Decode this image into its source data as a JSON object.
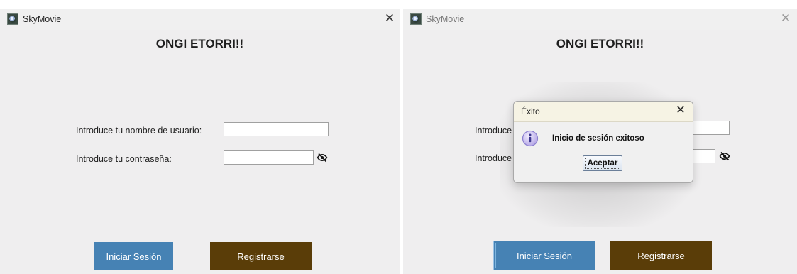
{
  "app": {
    "title": "SkyMovie",
    "close_glyph": "✕",
    "icon": "skymovie-app-icon"
  },
  "login_form": {
    "heading": "ONGI ETORRI!!",
    "username_label": "Introduce tu nombre de usuario:",
    "username_value": "",
    "password_label": "Introduce tu contraseña:",
    "password_value": "",
    "password_toggle_icon": "eye-slash-icon",
    "login_button": "Iniciar Sesión",
    "register_button": "Registrarse"
  },
  "right_window": {
    "username_label_partial": "Introduce",
    "password_label_partial": "Introduce"
  },
  "dialog": {
    "title": "Éxito",
    "message": "Inicio de sesión exitoso",
    "accept_button": "Aceptar",
    "icon": "info-icon"
  },
  "colors": {
    "window_bg": "#efeeef",
    "login_button_bg": "#4682b4",
    "register_button_bg": "#5a3d08",
    "dialog_titlebar_bg": "#f6f3e4"
  }
}
